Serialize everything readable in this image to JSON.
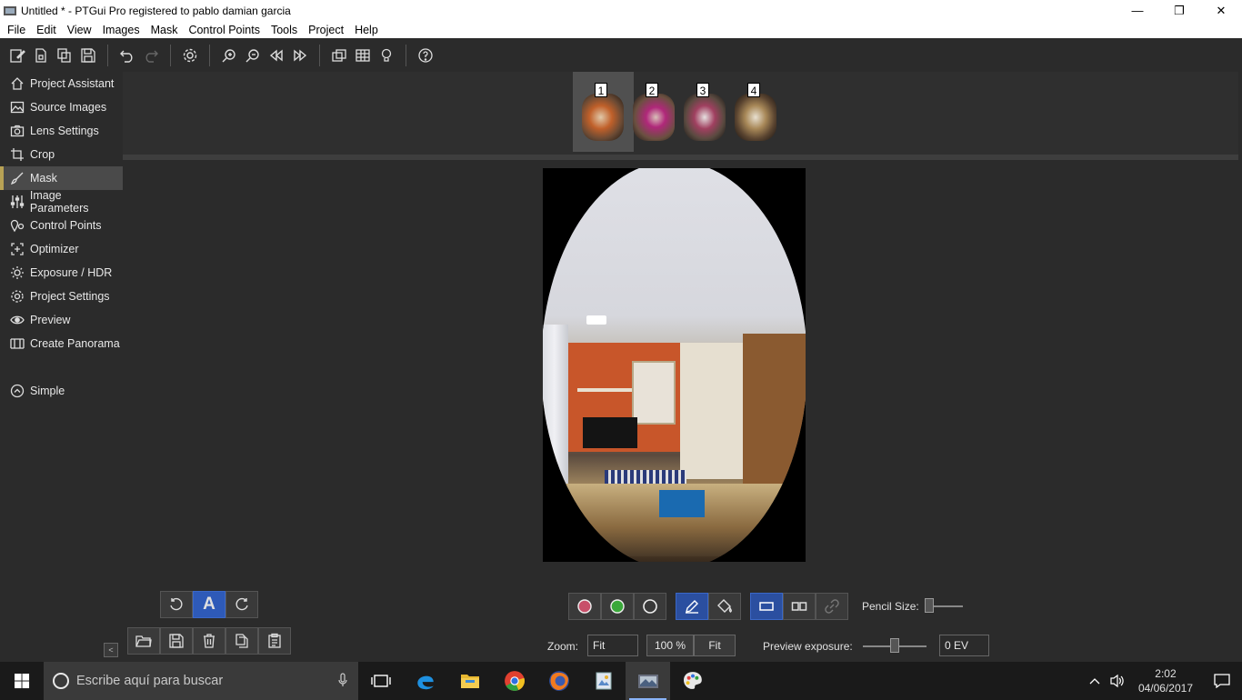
{
  "window": {
    "title": "Untitled * - PTGui Pro registered to pablo damian garcia",
    "minimize": "—",
    "maximize": "❐",
    "close": "✕"
  },
  "menu": [
    "File",
    "Edit",
    "View",
    "Images",
    "Mask",
    "Control Points",
    "Tools",
    "Project",
    "Help"
  ],
  "toolbar_icons": [
    "new-project-icon",
    "open-project-icon",
    "duplicate-icon",
    "save-icon",
    "undo-icon",
    "redo-icon",
    "settings-icon",
    "zoom-in-icon",
    "zoom-out-icon",
    "previous-icon",
    "next-icon",
    "panorama-editor-icon",
    "table-icon",
    "lightbulb-icon",
    "help-icon"
  ],
  "sidebar": {
    "items": [
      {
        "label": "Project Assistant",
        "icon": "home-icon"
      },
      {
        "label": "Source Images",
        "icon": "image-icon"
      },
      {
        "label": "Lens Settings",
        "icon": "camera-icon"
      },
      {
        "label": "Crop",
        "icon": "crop-icon"
      },
      {
        "label": "Mask",
        "icon": "brush-icon",
        "active": true
      },
      {
        "label": "Image Parameters",
        "icon": "sliders-icon"
      },
      {
        "label": "Control Points",
        "icon": "location-pin-icon"
      },
      {
        "label": "Optimizer",
        "icon": "optimizer-icon"
      },
      {
        "label": "Exposure / HDR",
        "icon": "sun-icon"
      },
      {
        "label": "Project Settings",
        "icon": "gear-icon"
      },
      {
        "label": "Preview",
        "icon": "eye-icon"
      },
      {
        "label": "Create Panorama",
        "icon": "panorama-icon"
      }
    ],
    "simple": "Simple",
    "collapse": "<"
  },
  "thumbnails": [
    {
      "num": "1",
      "selected": true
    },
    {
      "num": "2"
    },
    {
      "num": "3"
    },
    {
      "num": "4"
    }
  ],
  "mask_tools": {
    "pencil_size_label": "Pencil Size:",
    "zoom_label": "Zoom:",
    "zoom_value": "Fit",
    "zoom_100": "100 %",
    "zoom_fit": "Fit",
    "preview_exposure_label": "Preview exposure:",
    "preview_exposure_value": "0 EV",
    "text_tool": "A"
  },
  "taskbar": {
    "search_placeholder": "Escribe aquí para buscar",
    "time": "2:02",
    "date": "04/06/2017"
  },
  "colors": {
    "accent_blue": "#2e5ab8",
    "active_marker": "#b8a255",
    "mask_red": "#c8506a",
    "mask_green": "#3aa83a"
  }
}
